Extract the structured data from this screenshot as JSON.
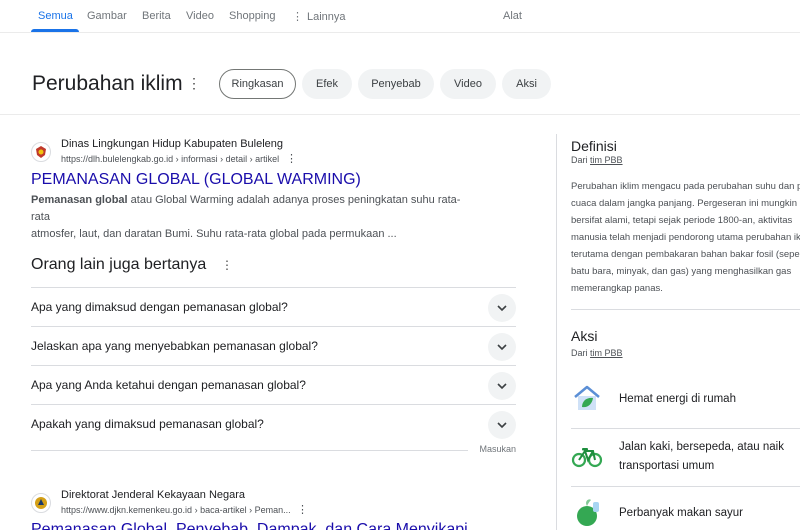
{
  "nav": {
    "tabs": [
      {
        "label": "Semua",
        "active": true
      },
      {
        "label": "Gambar"
      },
      {
        "label": "Berita"
      },
      {
        "label": "Video"
      },
      {
        "label": "Shopping"
      },
      {
        "label": "Lainnya"
      }
    ],
    "tools": "Alat"
  },
  "topic": {
    "title": "Perubahan iklim",
    "chips": [
      "Ringkasan",
      "Efek",
      "Penyebab",
      "Video",
      "Aksi"
    ],
    "selected_chip": "Ringkasan"
  },
  "result1": {
    "site_name": "Dinas Lingkungan Hidup Kabupaten Buleleng",
    "url": "https://dlh.bulelengkab.go.id › informasi › detail › artikel",
    "title": "PEMANASAN GLOBAL (GLOBAL WARMING)",
    "snippet_bold": "Pemanasan global",
    "snippet_line1_rest": " atau Global Warming adalah adanya proses peningkatan suhu rata-rata",
    "snippet_line2": "atmosfer, laut, dan daratan Bumi. Suhu rata-rata global pada permukaan ..."
  },
  "paa": {
    "heading": "Orang lain juga bertanya",
    "questions": [
      "Apa yang dimaksud dengan pemanasan global?",
      "Jelaskan apa yang menyebabkan pemanasan global?",
      "Apa yang Anda ketahui dengan pemanasan global?",
      "Apakah yang dimaksud pemanasan global?"
    ],
    "feedback": "Masukan"
  },
  "result2": {
    "site_name": "Direktorat Jenderal Kekayaan Negara",
    "url": "https://www.djkn.kemenkeu.go.id › baca-artikel › Peman...",
    "title": "Pemanasan Global, Penyebab, Dampak, dan Cara Menyikapi"
  },
  "definition": {
    "heading": "Definisi",
    "from_prefix": "Dari",
    "from_link": "tim PBB",
    "lines": [
      "Perubahan iklim mengacu pada perubahan suhu dan pola",
      "cuaca dalam jangka panjang. Pergeseran ini mungkin",
      "bersifat alami, tetapi sejak periode 1800-an, aktivitas",
      "manusia telah menjadi pendorong utama perubahan iklim,",
      "terutama dengan pembakaran bahan bakar fosil (seperti",
      "batu bara, minyak, dan gas) yang menghasilkan gas",
      "memerangkap panas."
    ]
  },
  "actions": {
    "heading": "Aksi",
    "from_prefix": "Dari",
    "from_link": "tim PBB",
    "items": [
      {
        "label": "Hemat energi di rumah",
        "icon": "house-leaf-icon"
      },
      {
        "label_line1": "Jalan kaki, bersepeda, atau naik",
        "label_line2": "transportasi umum",
        "icon": "bicycle-icon"
      },
      {
        "label": "Perbanyak makan sayur",
        "icon": "vegetables-icon"
      }
    ]
  },
  "colors": {
    "accent": "#1a73e8",
    "link": "#1a0dab",
    "text": "#202124",
    "muted": "#4d5156"
  }
}
